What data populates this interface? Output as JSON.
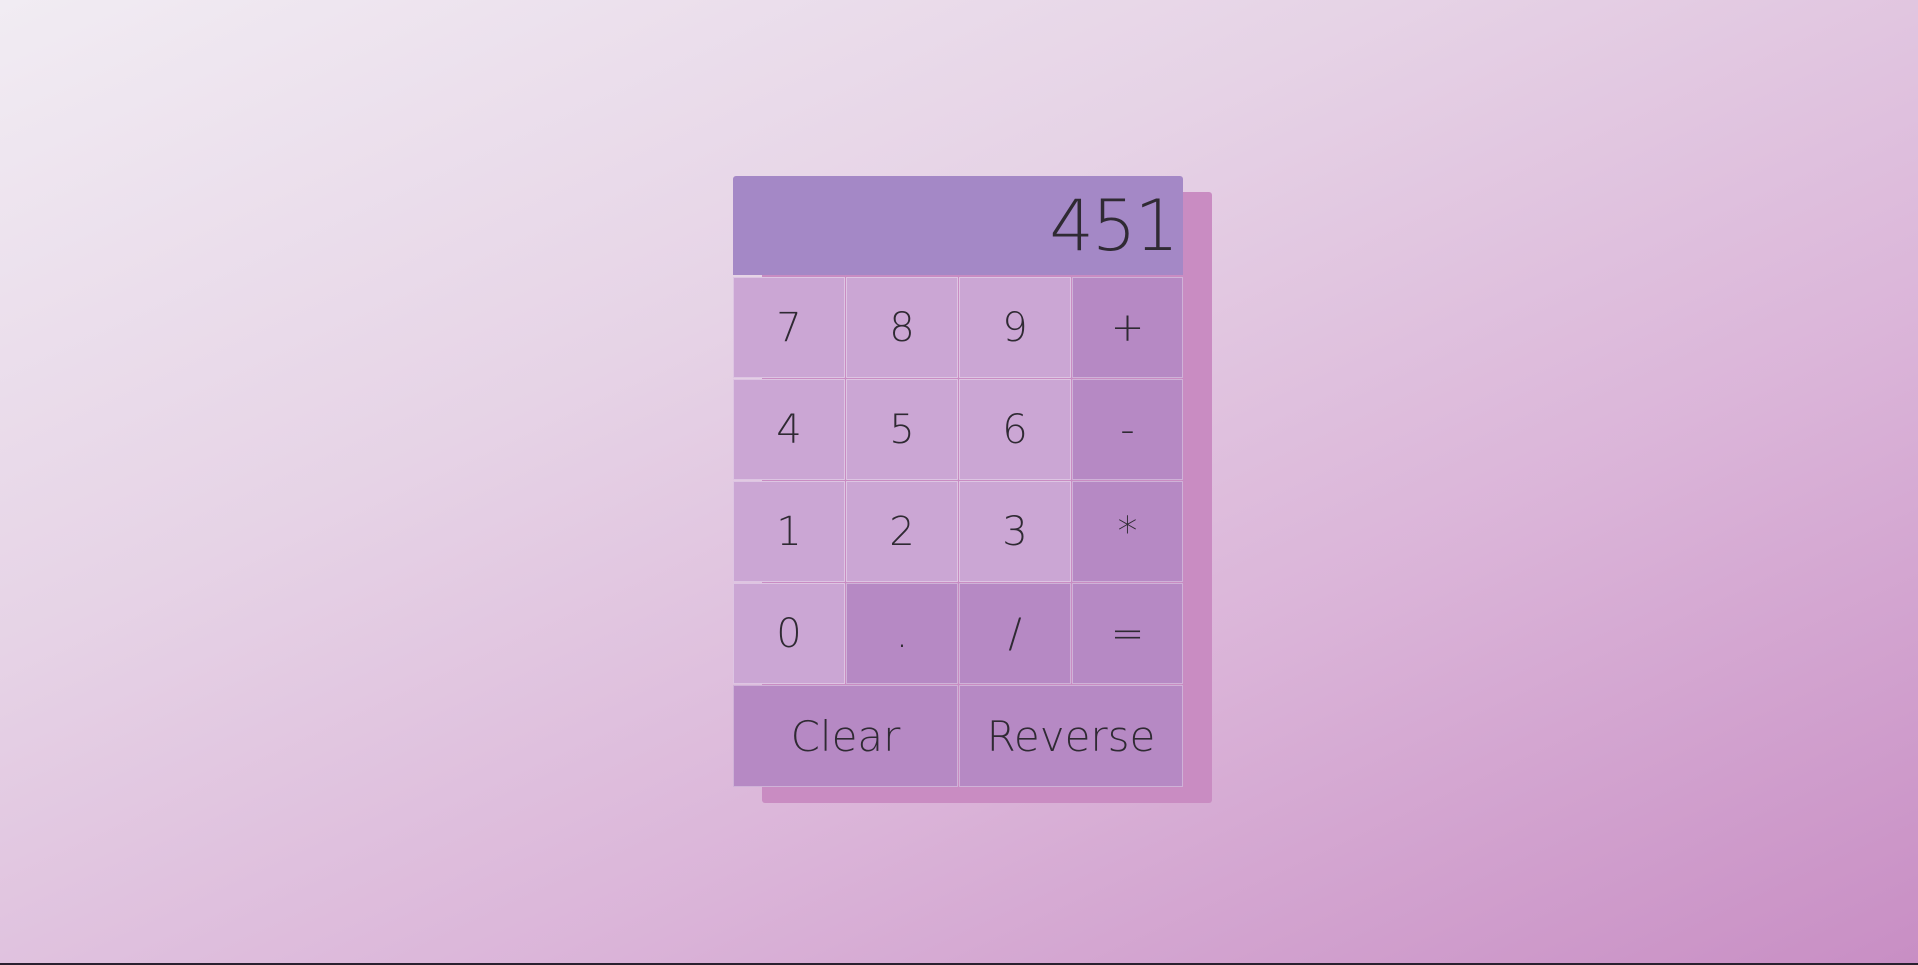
{
  "calculator": {
    "display": "451",
    "keys": {
      "seven": "7",
      "eight": "8",
      "nine": "9",
      "plus": "+",
      "four": "4",
      "five": "5",
      "six": "6",
      "minus": "-",
      "one": "1",
      "two": "2",
      "three": "3",
      "multiply": "*",
      "zero": "0",
      "decimal": ".",
      "divide": "/",
      "equals": "=",
      "clear": "Clear",
      "reverse": "Reverse"
    }
  },
  "colors": {
    "display_bg": "#a488c6",
    "number_key_bg": "#cba6d4",
    "operator_key_bg": "#b689c4",
    "shadow": "#c98cc2"
  }
}
